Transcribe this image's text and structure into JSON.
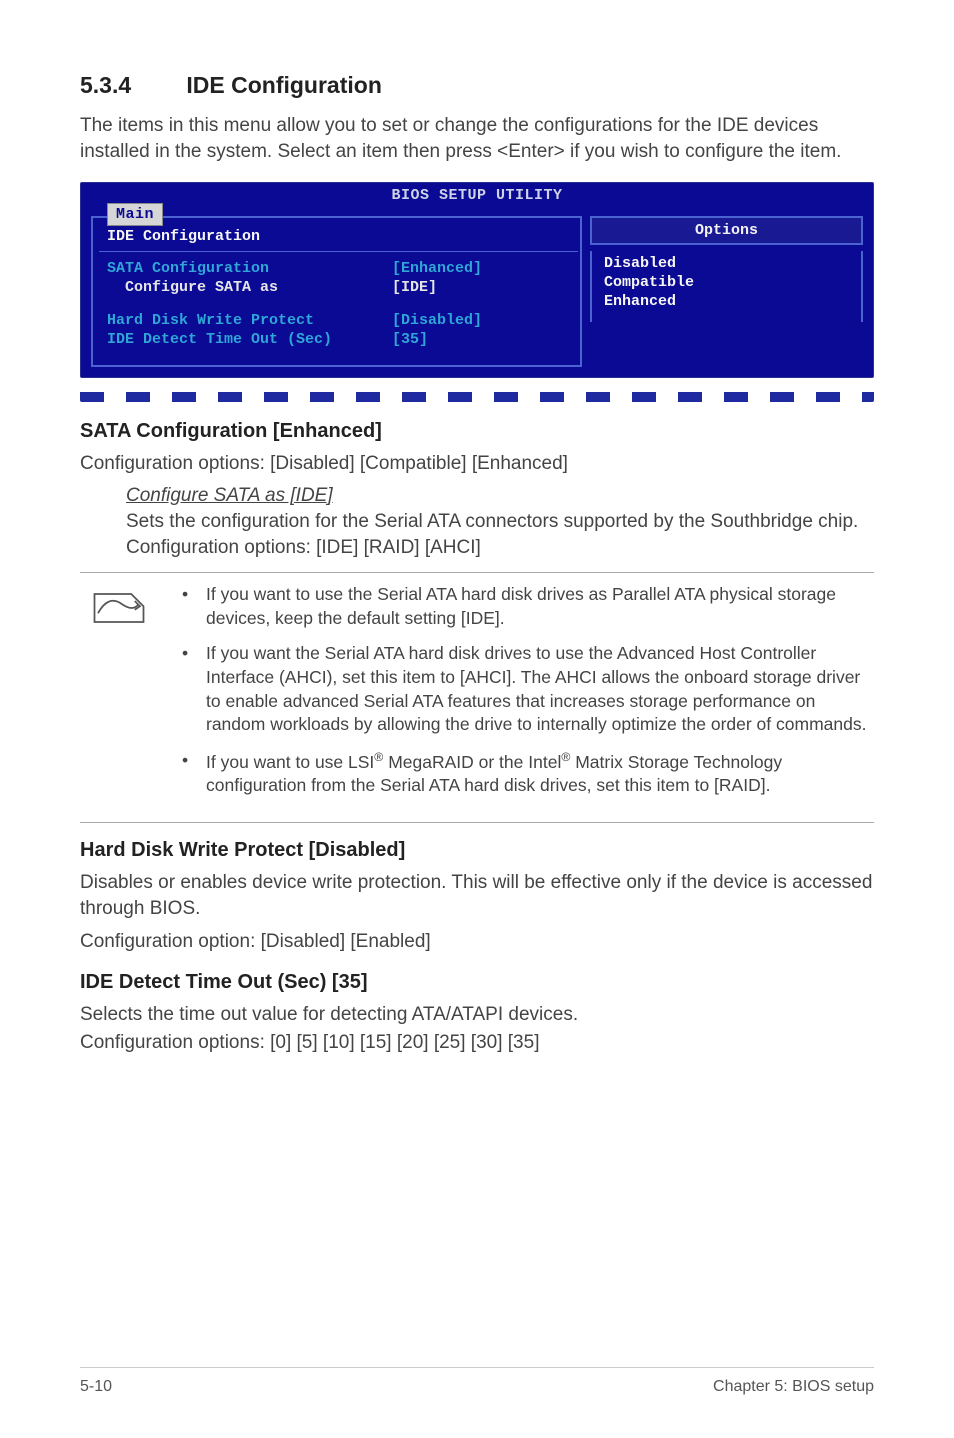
{
  "heading": {
    "number": "5.3.4",
    "title": "IDE Configuration"
  },
  "intro": "The items in this menu allow you to set or change the configurations for the IDE devices installed in the system. Select an item then press <Enter> if you wish to configure the item.",
  "bios": {
    "utility_title": "BIOS SETUP UTILITY",
    "tab": "Main",
    "panel_title": "IDE Configuration",
    "rows": [
      {
        "label": "SATA Configuration",
        "value": "[Enhanced]",
        "style": "blue"
      },
      {
        "label": "Configure SATA as",
        "value": "[IDE]",
        "style": "white",
        "indent": true
      },
      {
        "label": "Hard Disk Write Protect",
        "value": "[Disabled]",
        "style": "blue",
        "gap": true
      },
      {
        "label": "IDE Detect Time Out (Sec)",
        "value": "[35]",
        "style": "blue"
      }
    ],
    "options_header": "Options",
    "options": [
      "Disabled",
      "Compatible",
      "Enhanced"
    ]
  },
  "sections": [
    {
      "heading": "SATA Configuration [Enhanced]",
      "text": "Configuration options: [Disabled] [Compatible] [Enhanced]",
      "sub": {
        "link": "Configure SATA as [IDE]",
        "desc": "Sets the configuration for the Serial ATA connectors supported by the Southbridge chip. Configuration options: [IDE] [RAID] [AHCI]"
      }
    }
  ],
  "notes": [
    "If you want to use the Serial ATA hard disk drives as Parallel ATA physical storage devices, keep the default setting [IDE].",
    "If you want the Serial ATA hard disk drives to use the Advanced Host Controller Interface (AHCI), set this item to [AHCI]. The AHCI allows the onboard storage driver to enable advanced Serial ATA features that increases storage performance on random workloads by allowing the drive to internally optimize the order of commands.",
    "If you want to use LSI® MegaRAID or the Intel® Matrix Storage Technology configuration from the Serial ATA hard disk drives, set this item to [RAID]."
  ],
  "hd_protect": {
    "heading": "Hard Disk Write Protect [Disabled]",
    "text1": "Disables or enables device write protection. This will be effective only if the device is accessed through BIOS.",
    "text2": "Configuration option: [Disabled] [Enabled]"
  },
  "ide_timeout": {
    "heading": "IDE Detect Time Out (Sec) [35]",
    "text1": "Selects the time out value for detecting ATA/ATAPI devices.",
    "text2": "Configuration options: [0] [5] [10] [15] [20] [25] [30] [35]"
  },
  "footer": {
    "left": "5-10",
    "right": "Chapter 5: BIOS setup"
  }
}
